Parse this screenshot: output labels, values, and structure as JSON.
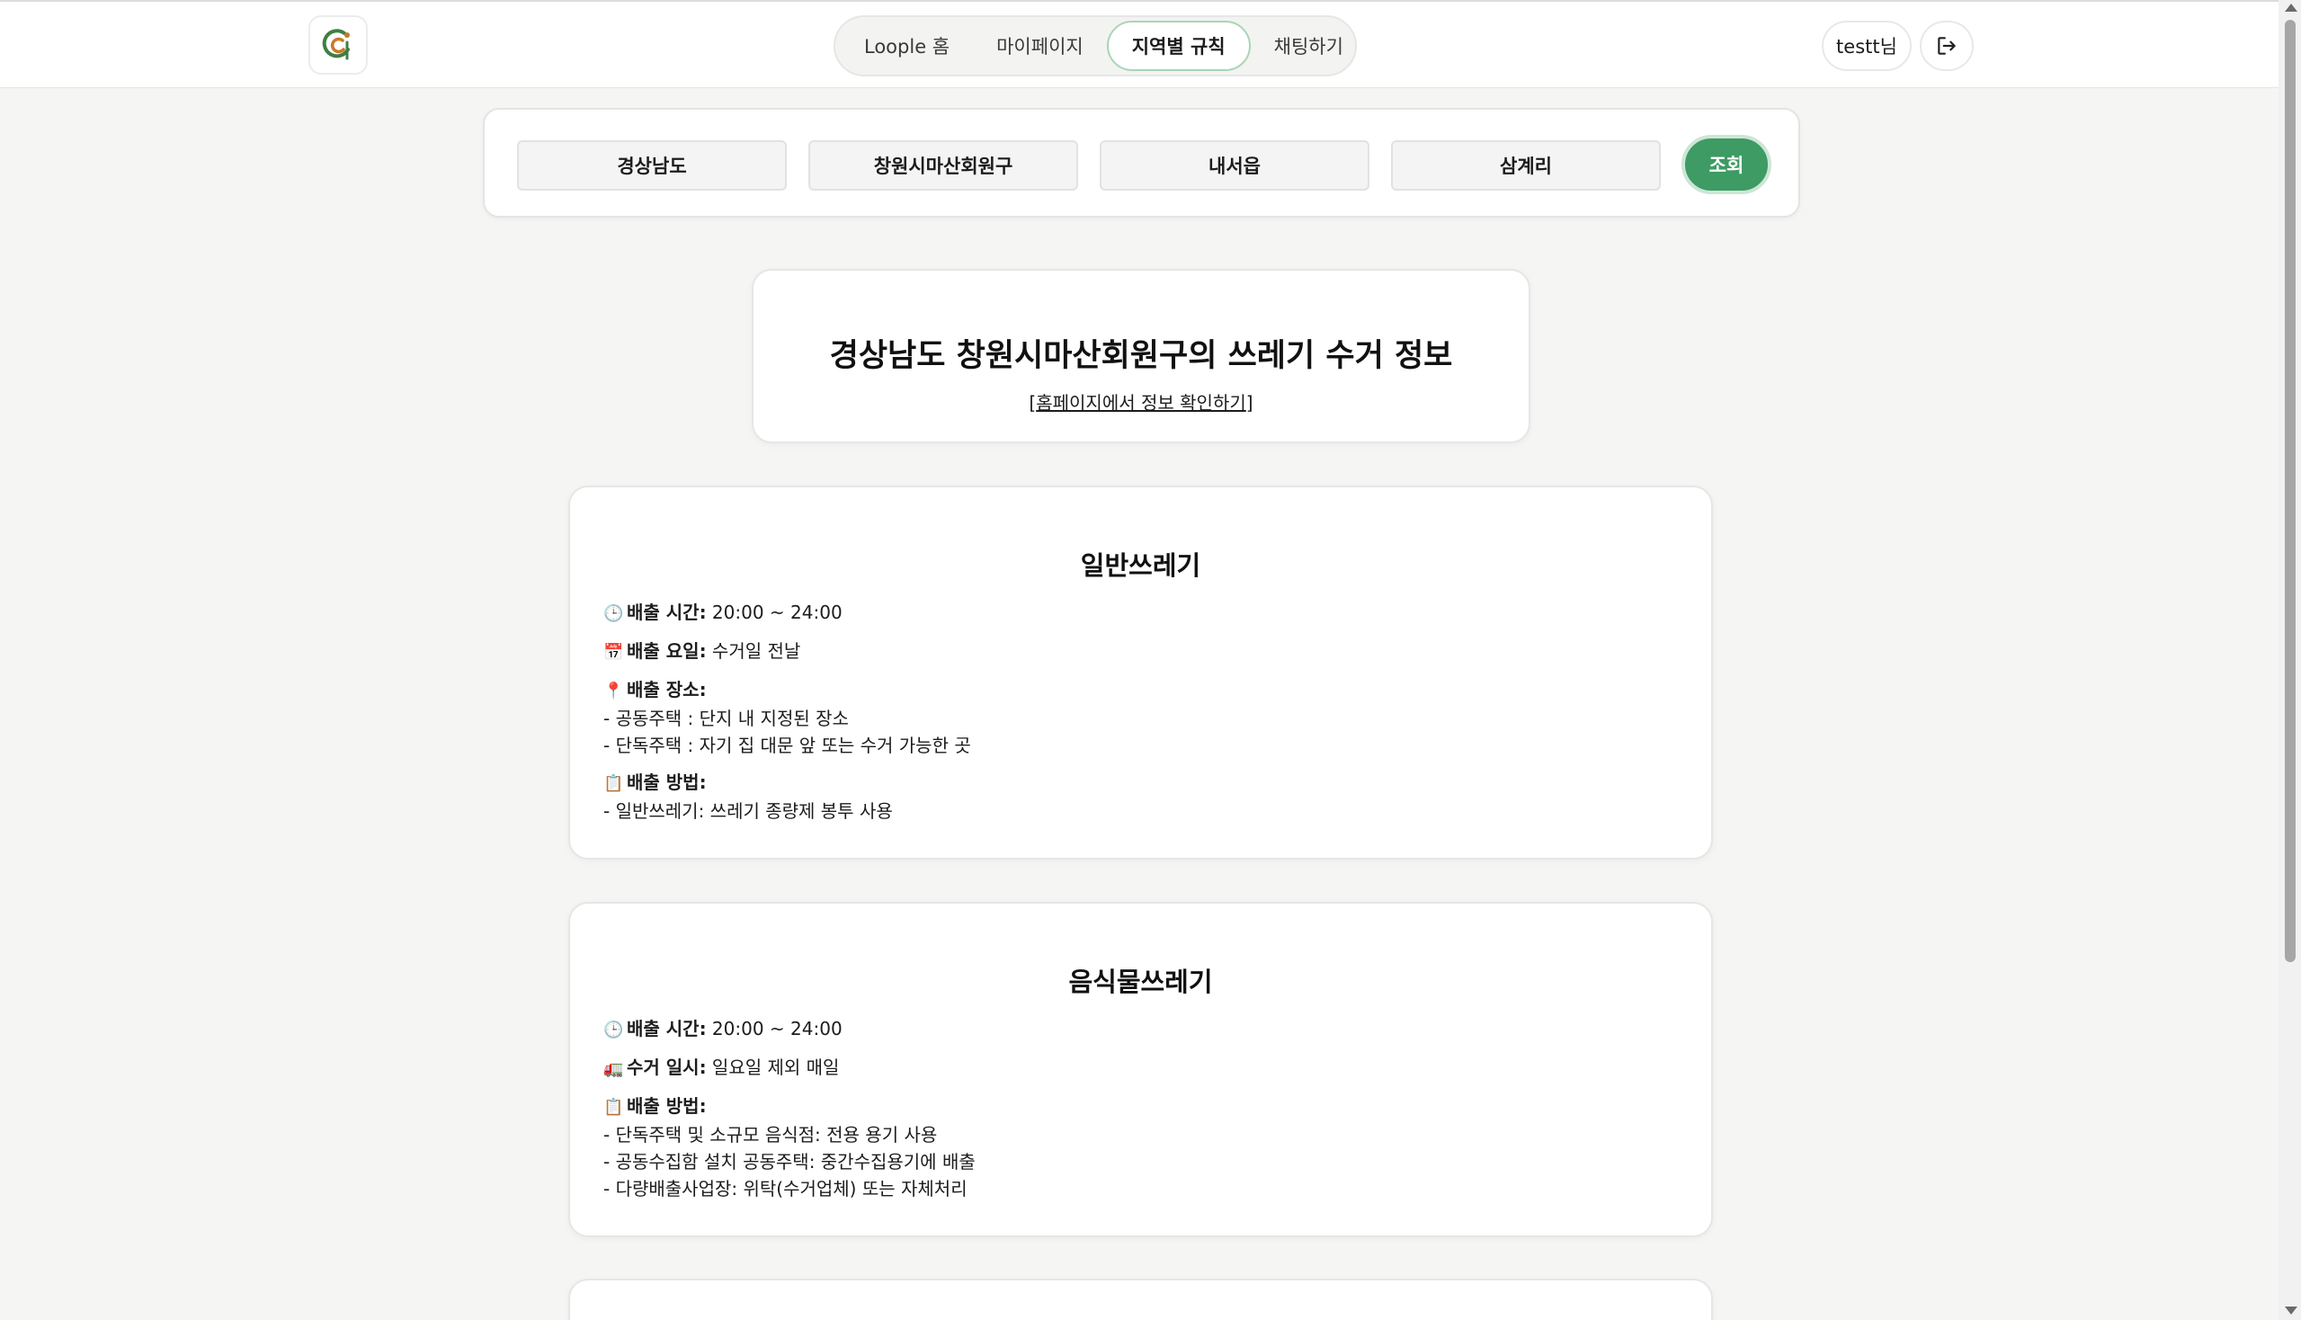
{
  "header": {
    "nav": [
      "Loople 홈",
      "마이페이지",
      "지역별 규칙",
      "채팅하기"
    ],
    "active_nav": "지역별 규칙",
    "user": "testt님"
  },
  "filters": {
    "province": "경상남도",
    "city": "창원시마산회원구",
    "district": "내서읍",
    "village": "삼계리",
    "search_label": "조회"
  },
  "title": {
    "heading": "경상남도 창원시마산회원구의 쓰레기 수거 정보",
    "link_open": "[",
    "link_text": "홈페이지에서 정보 확인하기",
    "link_close": "]"
  },
  "cards": [
    {
      "title": "일반쓰레기",
      "fields": [
        {
          "icon": "clock-icon",
          "label": "배출 시간:",
          "value": "20:00 ~ 24:00",
          "lines": []
        },
        {
          "icon": "calendar-icon",
          "label": "배출 요일:",
          "value": "수거일 전날",
          "lines": []
        },
        {
          "icon": "pin-icon",
          "label": "배출 장소:",
          "value": "",
          "lines": [
            "- 공동주택 : 단지 내 지정된 장소",
            "- 단독주택 : 자기 집 대문 앞 또는 수거 가능한 곳"
          ]
        },
        {
          "icon": "clipboard-icon",
          "label": "배출 방법:",
          "value": "",
          "lines": [
            "- 일반쓰레기: 쓰레기 종량제 봉투 사용"
          ]
        }
      ]
    },
    {
      "title": "음식물쓰레기",
      "fields": [
        {
          "icon": "clock-icon",
          "label": "배출 시간:",
          "value": "20:00 ~ 24:00",
          "lines": []
        },
        {
          "icon": "truck-icon",
          "label": "수거 일시:",
          "value": "일요일 제외 매일",
          "lines": []
        },
        {
          "icon": "clipboard-icon",
          "label": "배출 방법:",
          "value": "",
          "lines": [
            "- 단독주택 및 소규모 음식점: 전용 용기 사용",
            "- 공동수집함 설치 공동주택: 중간수집용기에 배출",
            "- 다량배출사업장: 위탁(수거업체) 또는 자체처리"
          ]
        }
      ]
    }
  ]
}
